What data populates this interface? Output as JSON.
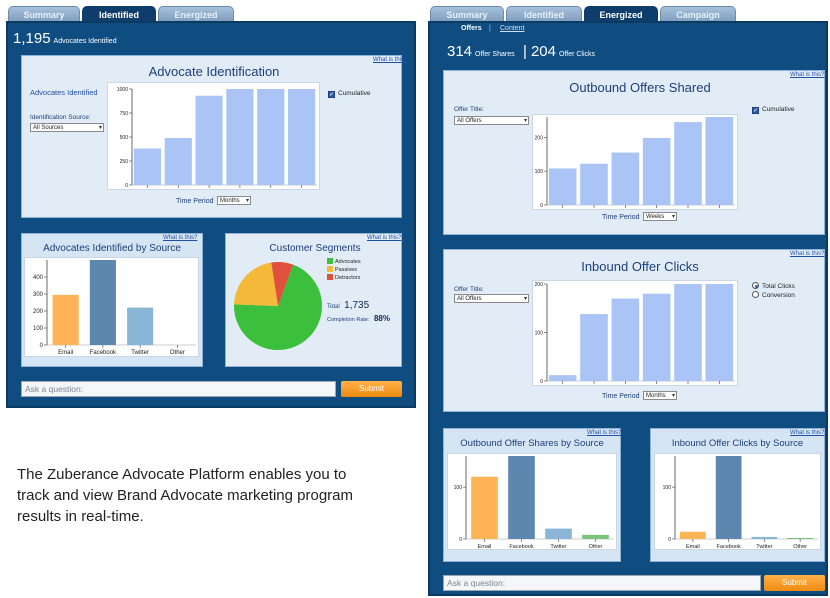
{
  "left": {
    "tabs": [
      "Summary",
      "Identified",
      "Energized"
    ],
    "active_tab": "Identified",
    "headline": {
      "number": "1,195",
      "text": "Advocates Identified"
    },
    "what_is_this": "What is this?",
    "advocate_id": {
      "title": "Advocate Identification",
      "side_label": "Advocates Identified",
      "source_label": "Identification Source:",
      "source_value": "All Sources",
      "cumulative_label": "Cumulative",
      "time_label": "Time Period",
      "time_value": "Months"
    },
    "by_source": {
      "title": "Advocates Identified by Source"
    },
    "segments": {
      "title": "Customer Segments",
      "legend": [
        "Advocates",
        "Passives",
        "Detractors"
      ],
      "total_label": "Total",
      "total_value": "1,735",
      "completion_label": "Completion Rate:",
      "completion_value": "88%"
    },
    "ask_placeholder": "Ask a question:",
    "submit_label": "Submit"
  },
  "right": {
    "tabs": [
      "Summary",
      "Identified",
      "Energized",
      "Campaign"
    ],
    "active_tab": "Energized",
    "subtabs": [
      "Offers",
      "Content"
    ],
    "headline": {
      "shares_number": "314",
      "shares_text": "Offer Shares",
      "sep": "|",
      "clicks_number": "204",
      "clicks_text": "Offer Clicks"
    },
    "what_is_this": "What is this?",
    "outbound": {
      "title": "Outbound Offers Shared",
      "offer_label": "Offer Title:",
      "offer_value": "All Offers",
      "cumulative_label": "Cumulative",
      "time_label": "Time Period",
      "time_value": "Weeks"
    },
    "inbound": {
      "title": "Inbound Offer Clicks",
      "offer_label": "Offer Title:",
      "offer_value": "All Offers",
      "radio_total": "Total Clicks",
      "radio_conversion": "Conversion",
      "time_label": "Time Period",
      "time_value": "Months"
    },
    "out_by_source": {
      "title": "Outbound Offer Shares by Source"
    },
    "in_by_source": {
      "title": "Inbound Offer Clicks by Source"
    },
    "ask_placeholder": "Ask a question:",
    "submit_label": "Submit"
  },
  "description": "The Zuberance Advocate Platform enables you to track and view Brand Advocate marketing program results in real-time.",
  "colors": {
    "panel": "#0f4d80",
    "bar": "#a9c4f5",
    "orange": "#ffb357",
    "steel": "#5e87b0",
    "teal": "#89b5d6",
    "green": "#3cbf3c",
    "yellow": "#f5b93a",
    "red": "#e0503c"
  },
  "chart_data": [
    {
      "id": "adv_ident",
      "type": "bar",
      "categories": [
        "1",
        "2",
        "3",
        "4",
        "5",
        "6"
      ],
      "values": [
        380,
        490,
        930,
        1010,
        1020,
        1020
      ],
      "ylim": [
        0,
        1000
      ],
      "yticks": [
        0,
        250,
        500,
        750,
        1000
      ]
    },
    {
      "id": "adv_by_source",
      "type": "bar",
      "categories": [
        "Email",
        "Facebook",
        "Twitter",
        "Other"
      ],
      "values": [
        295,
        500,
        220,
        0
      ],
      "ylim": [
        0,
        500
      ],
      "yticks": [
        0,
        100,
        200,
        300,
        400
      ]
    },
    {
      "id": "segments",
      "type": "pie",
      "labels": [
        "Advocates",
        "Passives",
        "Detractors"
      ],
      "values": [
        70,
        22,
        8
      ]
    },
    {
      "id": "outbound",
      "type": "bar",
      "categories": [
        "1",
        "2",
        "3",
        "4",
        "5",
        "6"
      ],
      "values": [
        108,
        122,
        155,
        198,
        245,
        270
      ],
      "ylim": [
        0,
        260
      ],
      "yticks": [
        0,
        100,
        200
      ]
    },
    {
      "id": "inbound",
      "type": "bar",
      "categories": [
        "1",
        "2",
        "3",
        "4",
        "5",
        "6"
      ],
      "values": [
        12,
        138,
        170,
        180,
        205,
        205
      ],
      "ylim": [
        0,
        200
      ],
      "yticks": [
        0,
        100,
        200
      ]
    },
    {
      "id": "out_by_source",
      "type": "bar",
      "categories": [
        "Email",
        "Facebook",
        "Twitter",
        "Other"
      ],
      "values": [
        120,
        170,
        20,
        8
      ],
      "ylim": [
        0,
        160
      ],
      "yticks": [
        0,
        100
      ]
    },
    {
      "id": "in_by_source",
      "type": "bar",
      "categories": [
        "Email",
        "Facebook",
        "Twitter",
        "Other"
      ],
      "values": [
        14,
        170,
        4,
        2
      ],
      "ylim": [
        0,
        160
      ],
      "yticks": [
        0,
        100
      ]
    }
  ]
}
